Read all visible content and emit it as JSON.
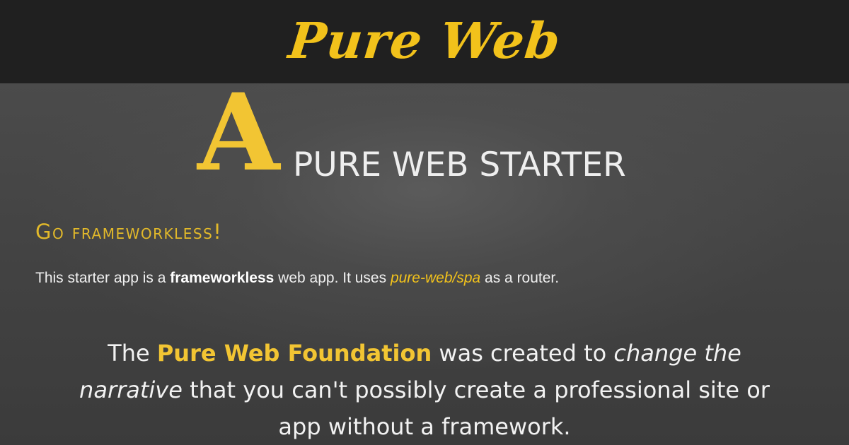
{
  "header": {
    "brand": "Pure Web"
  },
  "hero": {
    "cap": "A",
    "rest": "PURE WEB STARTER"
  },
  "subhead": "Go frameworkless!",
  "intro": {
    "t1": "This starter app is a ",
    "bold": "frameworkless",
    "t2": " web app. It uses ",
    "router": "pure-web/spa",
    "t3": " as a router."
  },
  "statement": {
    "t1": "The ",
    "highlight": "Pure Web Foundation",
    "t2": " was created to ",
    "em": "change the narrative",
    "t3": " that you can't possibly create a professional site or app without a framework."
  },
  "colors": {
    "accent": "#f2c21b",
    "header_bg": "#202020",
    "body_bg": "#454545",
    "text": "#eeeeee"
  }
}
